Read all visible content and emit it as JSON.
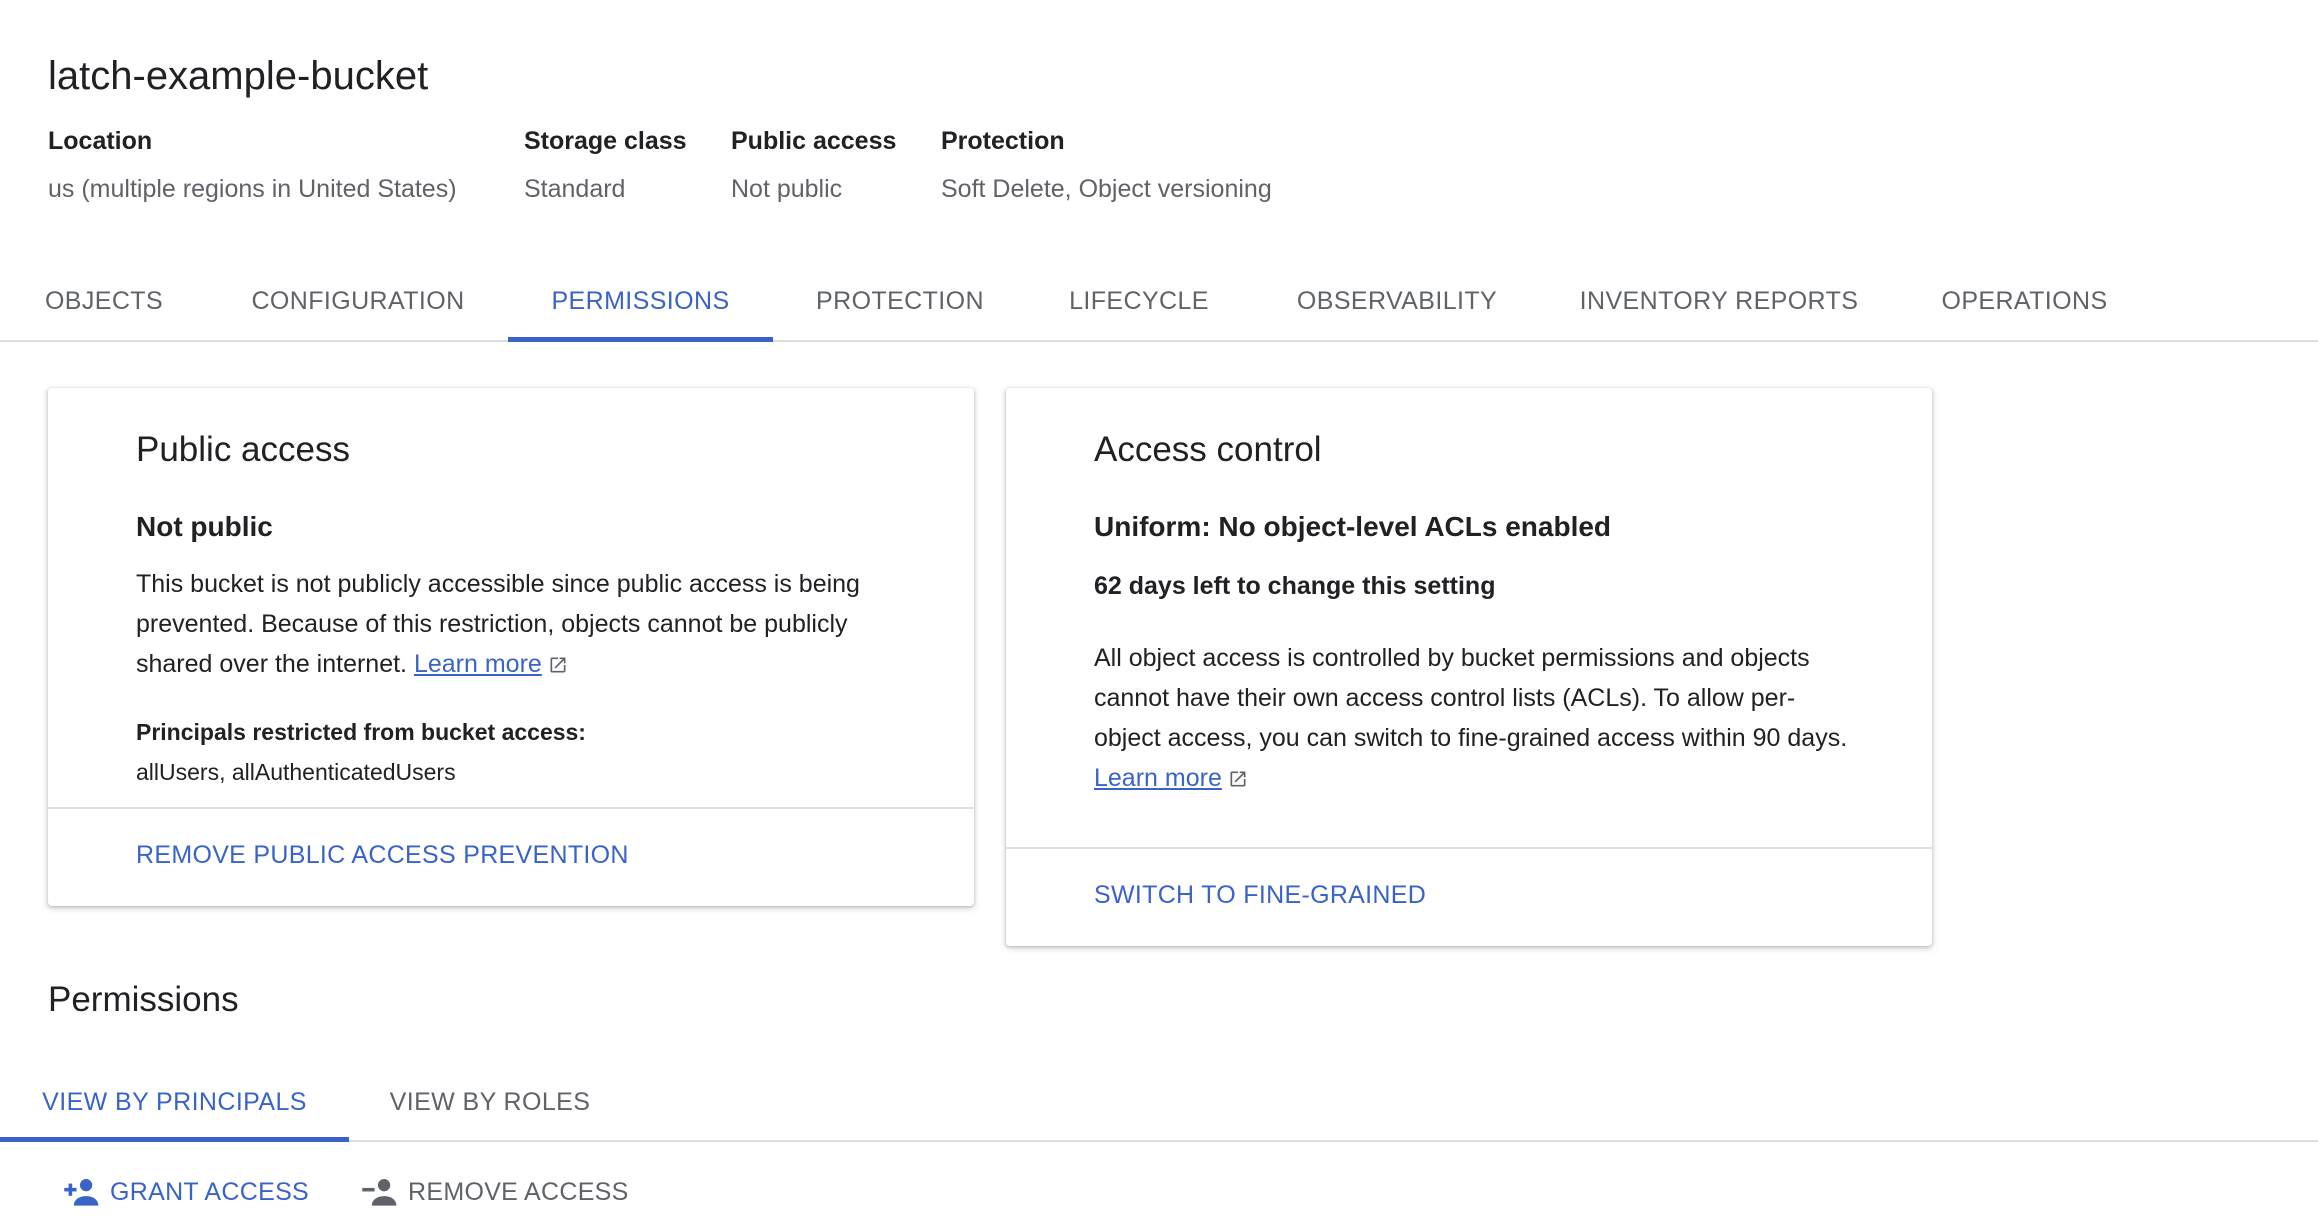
{
  "bucket": {
    "name": "latch-example-bucket",
    "meta": [
      {
        "label": "Location",
        "value": "us (multiple regions in United States)"
      },
      {
        "label": "Storage class",
        "value": "Standard"
      },
      {
        "label": "Public access",
        "value": "Not public"
      },
      {
        "label": "Protection",
        "value": "Soft Delete, Object versioning"
      }
    ]
  },
  "tabs": [
    {
      "label": "OBJECTS"
    },
    {
      "label": "CONFIGURATION"
    },
    {
      "label": "PERMISSIONS"
    },
    {
      "label": "PROTECTION"
    },
    {
      "label": "LIFECYCLE"
    },
    {
      "label": "OBSERVABILITY"
    },
    {
      "label": "INVENTORY REPORTS"
    },
    {
      "label": "OPERATIONS"
    }
  ],
  "active_tab": "PERMISSIONS",
  "public_access_card": {
    "title": "Public access",
    "status": "Not public",
    "description_lines": [
      "This bucket is not publicly accessible since public access is being",
      "prevented. Because of this restriction, objects cannot be publicly",
      "shared over the internet."
    ],
    "learn_more": "Learn more",
    "principals_label": "Principals restricted from bucket access:",
    "principals_value": "allUsers, allAuthenticatedUsers",
    "action": "REMOVE PUBLIC ACCESS PREVENTION"
  },
  "access_control_card": {
    "title": "Access control",
    "status": "Uniform: No object-level ACLs enabled",
    "days_left": "62 days left to change this setting",
    "description_lines": [
      "All object access is controlled by bucket permissions and objects",
      "cannot have their own access control lists (ACLs). To allow per-",
      "object access, you can switch to fine-grained access within 90 days."
    ],
    "learn_more": "Learn more",
    "action": "SWITCH TO FINE-GRAINED"
  },
  "permissions": {
    "heading": "Permissions",
    "subtabs": [
      {
        "label": "VIEW BY PRINCIPALS"
      },
      {
        "label": "VIEW BY ROLES"
      }
    ],
    "active_subtab": "VIEW BY PRINCIPALS",
    "grant_access": "GRANT ACCESS",
    "remove_access": "REMOVE ACCESS",
    "grant_icon": "person-add-icon",
    "remove_icon": "person-remove-icon"
  },
  "colors": {
    "accent": "#3a63c9",
    "text": "#202124",
    "muted": "#5f6368",
    "divider": "#dadce0"
  }
}
